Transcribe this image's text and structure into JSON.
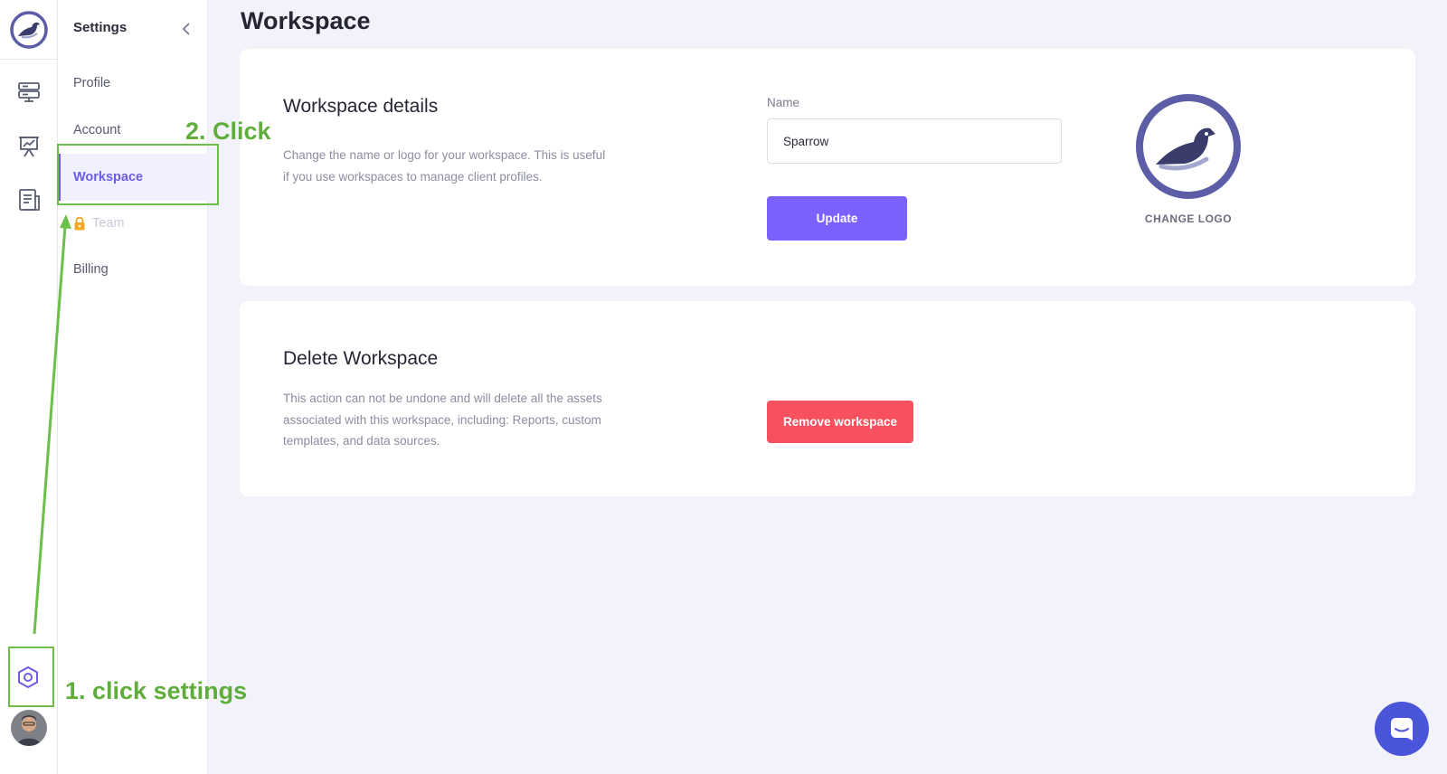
{
  "rail": {
    "icons": [
      "servers-icon",
      "presentation-chart-icon",
      "document-icon"
    ]
  },
  "settings": {
    "title": "Settings",
    "items": [
      {
        "label": "Profile"
      },
      {
        "label": "Account"
      },
      {
        "label": "Workspace",
        "active": true
      },
      {
        "label": "Team",
        "locked": true
      },
      {
        "label": "Billing"
      }
    ]
  },
  "page": {
    "title": "Workspace"
  },
  "details": {
    "heading": "Workspace details",
    "description": "Change the name or logo for your workspace. This is useful if you use workspaces to manage client profiles.",
    "name_label": "Name",
    "name_value": "Sparrow",
    "update_label": "Update",
    "change_logo_label": "CHANGE LOGO"
  },
  "delete": {
    "heading": "Delete Workspace",
    "description": "This action can not be undone and will delete all the assets associated with this workspace, including: Reports, custom templates, and data sources.",
    "remove_label": "Remove workspace"
  },
  "annotations": {
    "step1": "1. click settings",
    "step2": "2. Click"
  },
  "colors": {
    "accent": "#7b61ff",
    "danger": "#f7505f",
    "annotation": "#6cc04a",
    "logo": "#5b5ea6"
  }
}
